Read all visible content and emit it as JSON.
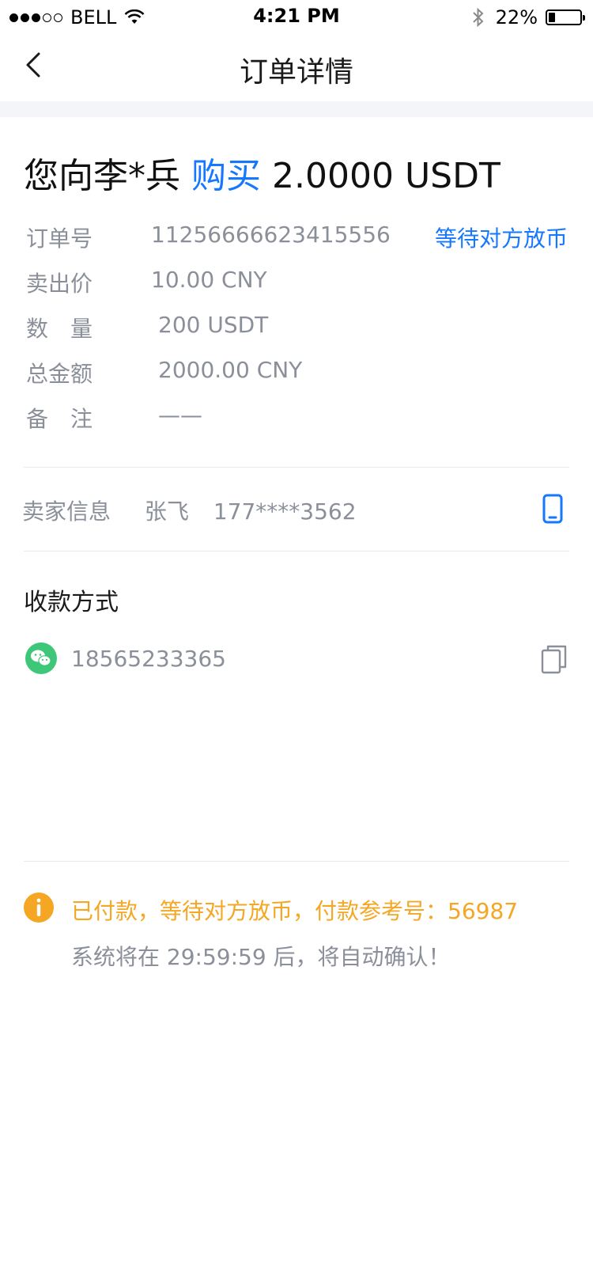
{
  "status_bar": {
    "carrier": "BELL",
    "time": "4:21 PM",
    "battery_percent": "22%",
    "battery_level": 0.22
  },
  "nav": {
    "title": "订单详情",
    "back_icon": "chevron-left-icon"
  },
  "headline": {
    "prefix": "您向李*兵",
    "action": "购买",
    "amount": "2.0000 USDT",
    "accent_color": "#1677ff"
  },
  "order": {
    "status": "等待对方放币",
    "fields": [
      {
        "label": "订单号",
        "value": "11256666623415556"
      },
      {
        "label": "卖出价",
        "value": "10.00 CNY"
      },
      {
        "label": "数　量",
        "value": "200 USDT"
      },
      {
        "label": "总金额",
        "value": "2000.00 CNY"
      },
      {
        "label": "备　注",
        "value": "——"
      }
    ]
  },
  "seller": {
    "label": "卖家信息",
    "name": "张飞",
    "phone": "177****3562",
    "phone_icon": "phone-icon"
  },
  "payment": {
    "title": "收款方式",
    "method_icon": "wechat-icon",
    "account": "18565233365",
    "copy_icon": "copy-icon"
  },
  "notice": {
    "icon": "info-icon",
    "main": "已付款，等待对方放币，付款参考号：56987",
    "sub": "系统将在 29:59:59  后，将自动确认！",
    "warning_color": "#f5a623"
  }
}
